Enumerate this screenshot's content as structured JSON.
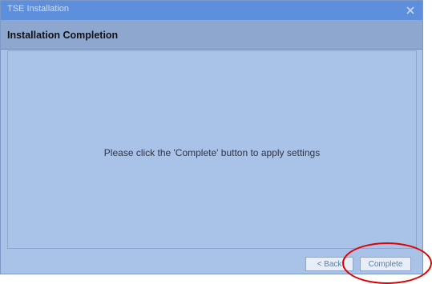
{
  "window": {
    "title": "TSE Installation",
    "close_icon": "close-icon"
  },
  "page": {
    "section_title": "Installation Completion",
    "message": "Please click the 'Complete' button to apply settings"
  },
  "footer": {
    "back_label": "< Back",
    "complete_label": "Complete"
  },
  "colors": {
    "window_bg": "#a9c2e8",
    "titlebar": "#5d8fdc",
    "highlight": "#e00000"
  }
}
